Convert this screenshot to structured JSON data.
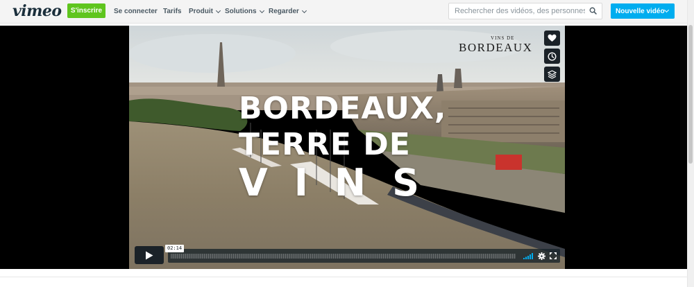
{
  "header": {
    "logo": "vimeo",
    "signup_label": "S'inscrire",
    "nav": [
      {
        "label": "Se connecter",
        "dropdown": false
      },
      {
        "label": "Tarifs",
        "dropdown": false
      },
      {
        "label": "Produit",
        "dropdown": true
      },
      {
        "label": "Solutions",
        "dropdown": true
      },
      {
        "label": "Regarder",
        "dropdown": true
      }
    ],
    "search_placeholder": "Rechercher des vidéos, des personnes, e",
    "new_video_label": "Nouvelle vidéo"
  },
  "video": {
    "title_line1": "BORDEAUX,",
    "title_line2": "TERRE DE",
    "title_line3": "VINS",
    "brand_small": "VINS DE",
    "brand_big": "BORDEAUX",
    "timecode": "02:14",
    "side_buttons": [
      "heart-icon",
      "clock-icon",
      "layers-icon"
    ]
  },
  "colors": {
    "signup": "#5fc51e",
    "new_video": "#00adef",
    "control_bg": "#1b2228",
    "volume": "#00adef"
  }
}
